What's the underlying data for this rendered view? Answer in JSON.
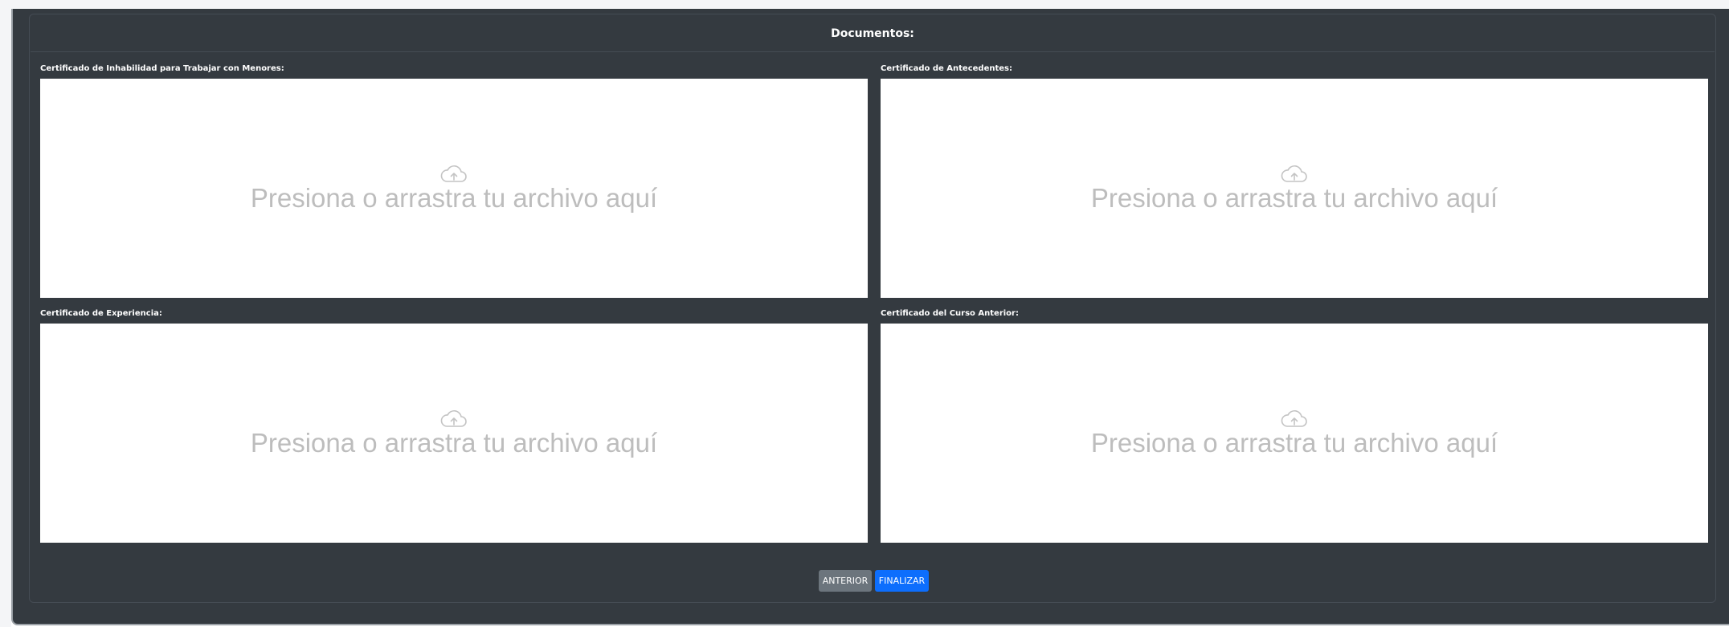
{
  "panel": {
    "title": "Documentos:"
  },
  "fields": [
    {
      "label": "Certificado de Inhabilidad para Trabajar con Menores:",
      "dropzone_text": "Presiona o arrastra tu archivo aquí",
      "icon": "cloud-upload-icon"
    },
    {
      "label": "Certificado de Antecedentes:",
      "dropzone_text": "Presiona o arrastra tu archivo aquí",
      "icon": "cloud-upload-icon"
    },
    {
      "label": "Certificado de Experiencia:",
      "dropzone_text": "Presiona o arrastra tu archivo aquí",
      "icon": "cloud-upload-icon"
    },
    {
      "label": "Certificado del Curso Anterior:",
      "dropzone_text": "Presiona o arrastra tu archivo aquí",
      "icon": "cloud-upload-icon"
    }
  ],
  "buttons": {
    "previous_label": "ANTERIOR",
    "finish_label": "FINALIZAR"
  },
  "colors": {
    "panel_background": "#343a40",
    "dropzone_background": "#ffffff",
    "dropzone_text": "#bdbdbd",
    "previous_button": "#6c757d",
    "finish_button": "#0d6efd"
  }
}
